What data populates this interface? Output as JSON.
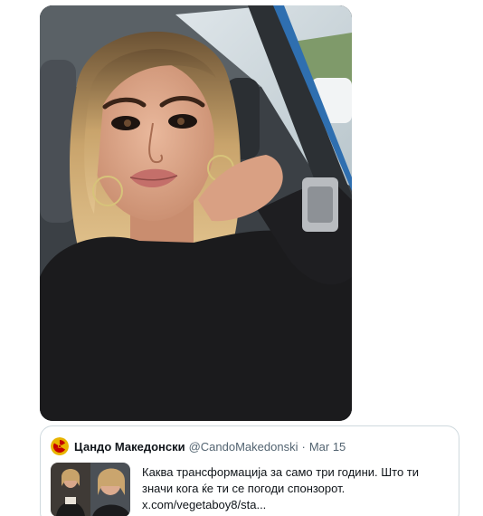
{
  "quoted_tweet": {
    "display_name": "Цандо Македонски",
    "handle": "@CandoMakedonski",
    "separator": "·",
    "date": "Mar 15",
    "text": "Каква трансформација за само три години. Што ти значи кога ќе ти се погоди спонзорот.",
    "link": "x.com/vegetaboy8/sta..."
  },
  "colors": {
    "name_text": "#0f1419",
    "meta_text": "#536471",
    "card_border": "#cfd9de",
    "avatar_bg": "#e8b400",
    "avatar_symbol": "#c40000"
  },
  "icons": {
    "avatar": "radiation-icon"
  }
}
